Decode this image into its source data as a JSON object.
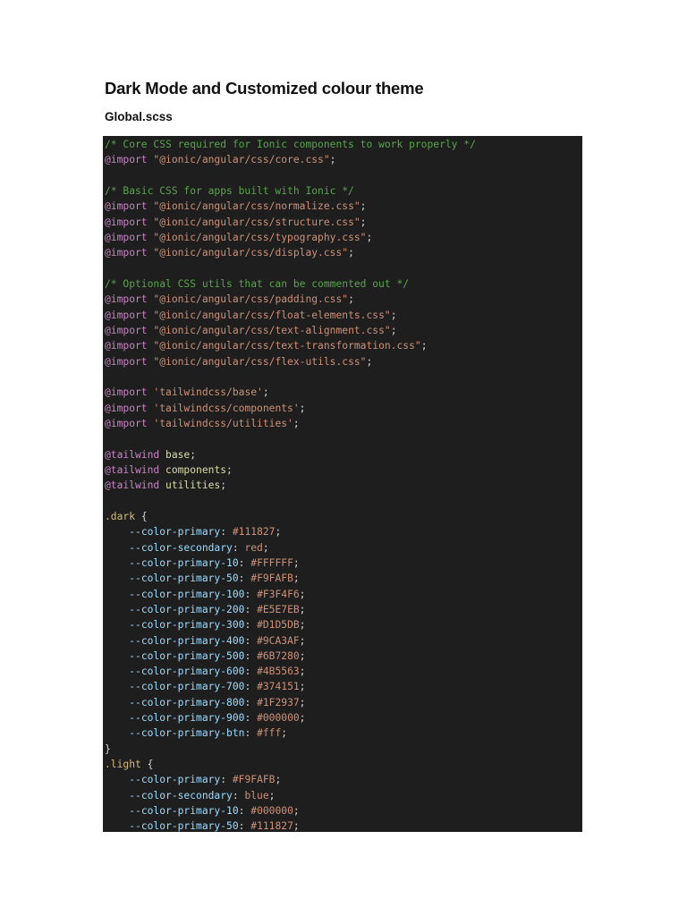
{
  "document": {
    "title": "Dark Mode and Customized colour theme",
    "subtitle": "Global.scss"
  },
  "code_lines": [
    [
      [
        "comment",
        "/* Core CSS required for Ionic components to work properly */"
      ]
    ],
    [
      [
        "at",
        "@import"
      ],
      [
        "plain",
        " "
      ],
      [
        "string",
        "\"@ionic/angular/css/core.css\""
      ],
      [
        "plain",
        ";"
      ]
    ],
    [],
    [
      [
        "comment",
        "/* Basic CSS for apps built with Ionic */"
      ]
    ],
    [
      [
        "at",
        "@import"
      ],
      [
        "plain",
        " "
      ],
      [
        "string",
        "\"@ionic/angular/css/normalize.css\""
      ],
      [
        "plain",
        ";"
      ]
    ],
    [
      [
        "at",
        "@import"
      ],
      [
        "plain",
        " "
      ],
      [
        "string",
        "\"@ionic/angular/css/structure.css\""
      ],
      [
        "plain",
        ";"
      ]
    ],
    [
      [
        "at",
        "@import"
      ],
      [
        "plain",
        " "
      ],
      [
        "string",
        "\"@ionic/angular/css/typography.css\""
      ],
      [
        "plain",
        ";"
      ]
    ],
    [
      [
        "at",
        "@import"
      ],
      [
        "plain",
        " "
      ],
      [
        "string",
        "\"@ionic/angular/css/display.css\""
      ],
      [
        "plain",
        ";"
      ]
    ],
    [],
    [
      [
        "comment",
        "/* Optional CSS utils that can be commented out */"
      ]
    ],
    [
      [
        "at",
        "@import"
      ],
      [
        "plain",
        " "
      ],
      [
        "string",
        "\"@ionic/angular/css/padding.css\""
      ],
      [
        "plain",
        ";"
      ]
    ],
    [
      [
        "at",
        "@import"
      ],
      [
        "plain",
        " "
      ],
      [
        "string",
        "\"@ionic/angular/css/float-elements.css\""
      ],
      [
        "plain",
        ";"
      ]
    ],
    [
      [
        "at",
        "@import"
      ],
      [
        "plain",
        " "
      ],
      [
        "string",
        "\"@ionic/angular/css/text-alignment.css\""
      ],
      [
        "plain",
        ";"
      ]
    ],
    [
      [
        "at",
        "@import"
      ],
      [
        "plain",
        " "
      ],
      [
        "string",
        "\"@ionic/angular/css/text-transformation.css\""
      ],
      [
        "plain",
        ";"
      ]
    ],
    [
      [
        "at",
        "@import"
      ],
      [
        "plain",
        " "
      ],
      [
        "string",
        "\"@ionic/angular/css/flex-utils.css\""
      ],
      [
        "plain",
        ";"
      ]
    ],
    [],
    [
      [
        "at",
        "@import"
      ],
      [
        "plain",
        " "
      ],
      [
        "string",
        "'tailwindcss/base'"
      ],
      [
        "plain",
        ";"
      ]
    ],
    [
      [
        "at",
        "@import"
      ],
      [
        "plain",
        " "
      ],
      [
        "string",
        "'tailwindcss/components'"
      ],
      [
        "plain",
        ";"
      ]
    ],
    [
      [
        "at",
        "@import"
      ],
      [
        "plain",
        " "
      ],
      [
        "string",
        "'tailwindcss/utilities'"
      ],
      [
        "plain",
        ";"
      ]
    ],
    [],
    [
      [
        "at",
        "@tailwind"
      ],
      [
        "plain",
        " "
      ],
      [
        "ident",
        "base"
      ],
      [
        "plain",
        ";"
      ]
    ],
    [
      [
        "at",
        "@tailwind"
      ],
      [
        "plain",
        " "
      ],
      [
        "ident",
        "components"
      ],
      [
        "plain",
        ";"
      ]
    ],
    [
      [
        "at",
        "@tailwind"
      ],
      [
        "plain",
        " "
      ],
      [
        "ident",
        "utilities"
      ],
      [
        "plain",
        ";"
      ]
    ],
    [],
    [
      [
        "selector",
        ".dark"
      ],
      [
        "plain",
        " {"
      ]
    ],
    [
      [
        "plain",
        "    "
      ],
      [
        "prop",
        "--color-primary"
      ],
      [
        "plain",
        ": "
      ],
      [
        "value",
        "#111827"
      ],
      [
        "plain",
        ";"
      ]
    ],
    [
      [
        "plain",
        "    "
      ],
      [
        "prop",
        "--color-secondary"
      ],
      [
        "plain",
        ": "
      ],
      [
        "value",
        "red"
      ],
      [
        "plain",
        ";"
      ]
    ],
    [
      [
        "plain",
        "    "
      ],
      [
        "prop",
        "--color-primary-10"
      ],
      [
        "plain",
        ": "
      ],
      [
        "value",
        "#FFFFFF"
      ],
      [
        "plain",
        ";"
      ]
    ],
    [
      [
        "plain",
        "    "
      ],
      [
        "prop",
        "--color-primary-50"
      ],
      [
        "plain",
        ": "
      ],
      [
        "value",
        "#F9FAFB"
      ],
      [
        "plain",
        ";"
      ]
    ],
    [
      [
        "plain",
        "    "
      ],
      [
        "prop",
        "--color-primary-100"
      ],
      [
        "plain",
        ": "
      ],
      [
        "value",
        "#F3F4F6"
      ],
      [
        "plain",
        ";"
      ]
    ],
    [
      [
        "plain",
        "    "
      ],
      [
        "prop",
        "--color-primary-200"
      ],
      [
        "plain",
        ": "
      ],
      [
        "value",
        "#E5E7EB"
      ],
      [
        "plain",
        ";"
      ]
    ],
    [
      [
        "plain",
        "    "
      ],
      [
        "prop",
        "--color-primary-300"
      ],
      [
        "plain",
        ": "
      ],
      [
        "value",
        "#D1D5DB"
      ],
      [
        "plain",
        ";"
      ]
    ],
    [
      [
        "plain",
        "    "
      ],
      [
        "prop",
        "--color-primary-400"
      ],
      [
        "plain",
        ": "
      ],
      [
        "value",
        "#9CA3AF"
      ],
      [
        "plain",
        ";"
      ]
    ],
    [
      [
        "plain",
        "    "
      ],
      [
        "prop",
        "--color-primary-500"
      ],
      [
        "plain",
        ": "
      ],
      [
        "value",
        "#6B7280"
      ],
      [
        "plain",
        ";"
      ]
    ],
    [
      [
        "plain",
        "    "
      ],
      [
        "prop",
        "--color-primary-600"
      ],
      [
        "plain",
        ": "
      ],
      [
        "value",
        "#4B5563"
      ],
      [
        "plain",
        ";"
      ]
    ],
    [
      [
        "plain",
        "    "
      ],
      [
        "prop",
        "--color-primary-700"
      ],
      [
        "plain",
        ": "
      ],
      [
        "value",
        "#374151"
      ],
      [
        "plain",
        ";"
      ]
    ],
    [
      [
        "plain",
        "    "
      ],
      [
        "prop",
        "--color-primary-800"
      ],
      [
        "plain",
        ": "
      ],
      [
        "value",
        "#1F2937"
      ],
      [
        "plain",
        ";"
      ]
    ],
    [
      [
        "plain",
        "    "
      ],
      [
        "prop",
        "--color-primary-900"
      ],
      [
        "plain",
        ": "
      ],
      [
        "value",
        "#000000"
      ],
      [
        "plain",
        ";"
      ]
    ],
    [
      [
        "plain",
        "    "
      ],
      [
        "prop",
        "--color-primary-btn"
      ],
      [
        "plain",
        ": "
      ],
      [
        "value",
        "#fff"
      ],
      [
        "plain",
        ";"
      ]
    ],
    [
      [
        "plain",
        "}"
      ]
    ],
    [
      [
        "selector",
        ".light"
      ],
      [
        "plain",
        " {"
      ]
    ],
    [
      [
        "plain",
        "    "
      ],
      [
        "prop",
        "--color-primary"
      ],
      [
        "plain",
        ": "
      ],
      [
        "value",
        "#F9FAFB"
      ],
      [
        "plain",
        ";"
      ]
    ],
    [
      [
        "plain",
        "    "
      ],
      [
        "prop",
        "--color-secondary"
      ],
      [
        "plain",
        ": "
      ],
      [
        "value",
        "blue"
      ],
      [
        "plain",
        ";"
      ]
    ],
    [
      [
        "plain",
        "    "
      ],
      [
        "prop",
        "--color-primary-10"
      ],
      [
        "plain",
        ": "
      ],
      [
        "value",
        "#000000"
      ],
      [
        "plain",
        ";"
      ]
    ],
    [
      [
        "plain",
        "    "
      ],
      [
        "prop",
        "--color-primary-50"
      ],
      [
        "plain",
        ": "
      ],
      [
        "value",
        "#111827"
      ],
      [
        "plain",
        ";"
      ]
    ]
  ]
}
